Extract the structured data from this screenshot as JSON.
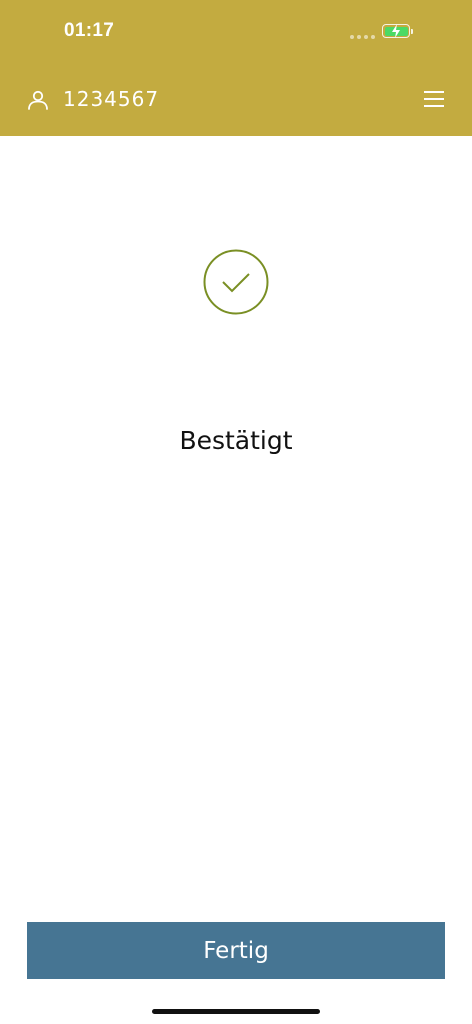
{
  "status_bar": {
    "time": "01:17",
    "battery_color": "#4cd964"
  },
  "header": {
    "background_color": "#c3ab40",
    "user_icon": "user-icon",
    "user_id": "1234567",
    "menu_icon": "hamburger-menu-icon"
  },
  "main": {
    "success_icon": "checkmark-circle-icon",
    "success_color": "#7a8f24",
    "title": "Bestätigt"
  },
  "footer": {
    "done_label": "Fertig",
    "button_color": "#467593"
  }
}
